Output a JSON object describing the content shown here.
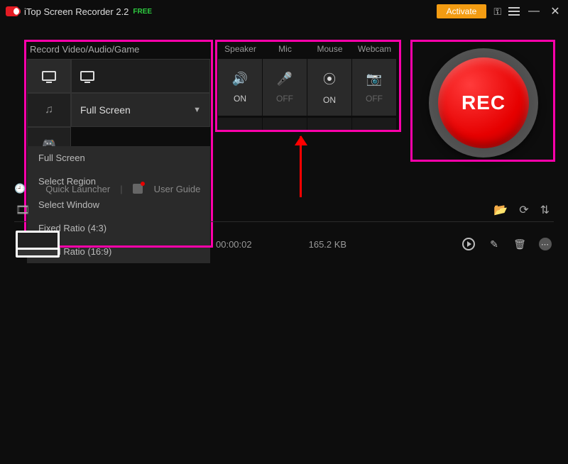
{
  "titlebar": {
    "app_name": "iTop Screen Recorder 2.2",
    "free_label": "FREE",
    "activate_label": "Activate"
  },
  "left_panel": {
    "title": "Record Video/Audio/Game",
    "selected_mode": "Full Screen",
    "dropdown": [
      "Full Screen",
      "Select Region",
      "Select Window",
      "Fixed Ratio (4:3)",
      "Fixed Ratio (16:9)"
    ]
  },
  "devices": {
    "cols": [
      {
        "label": "Speaker",
        "state": "ON"
      },
      {
        "label": "Mic",
        "state": "OFF"
      },
      {
        "label": "Mouse",
        "state": "ON"
      },
      {
        "label": "Webcam",
        "state": "OFF"
      }
    ]
  },
  "rec_button": {
    "label": "REC"
  },
  "midbar": {
    "quick_launcher": "Quick Launcher",
    "user_guide": "User Guide"
  },
  "recordings": [
    {
      "duration": "00:00:02",
      "size": "165.2 KB"
    }
  ]
}
